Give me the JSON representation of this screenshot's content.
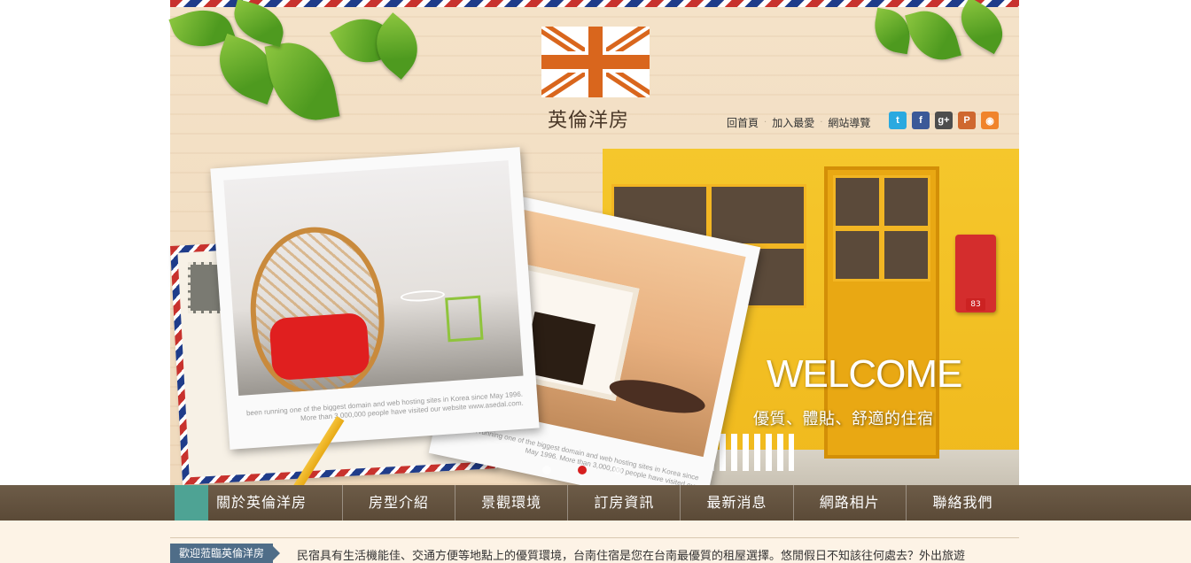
{
  "logo": {
    "name": "英倫洋房"
  },
  "top_links": [
    {
      "label": "回首頁"
    },
    {
      "label": "加入最愛"
    },
    {
      "label": "網站導覽"
    }
  ],
  "socials": [
    {
      "icon": "twitter-icon",
      "glyph": "t",
      "color": "#2aa9e0"
    },
    {
      "icon": "facebook-icon",
      "glyph": "f",
      "color": "#3b5998"
    },
    {
      "icon": "google-plus-icon",
      "glyph": "g+",
      "color": "#4d4d4d"
    },
    {
      "icon": "plurk-icon",
      "glyph": "P",
      "color": "#cf682f"
    },
    {
      "icon": "rss-icon",
      "glyph": "◉",
      "color": "#f0842c"
    }
  ],
  "hero": {
    "headline": "WELCOME",
    "tagline": "優質、體貼、舒適的住宿",
    "mailbox_number": "83",
    "photo1_caption": "been running one of the biggest domain and web hosting sites in Korea since May 1996. More than 3,000,000 people have visited our website www.asedal.com.",
    "photo2_caption": "been running one of the biggest domain and web hosting sites in Korea since May 1996. More than 3,000,000 people have visited our",
    "slides": 3,
    "active_slide": 1
  },
  "nav": {
    "items": [
      {
        "label": "關於英倫洋房"
      },
      {
        "label": "房型介紹"
      },
      {
        "label": "景觀環境"
      },
      {
        "label": "訂房資訊"
      },
      {
        "label": "最新消息"
      },
      {
        "label": "網路相片"
      },
      {
        "label": "聯絡我們"
      }
    ]
  },
  "intro": {
    "tag": "歡迎蒞臨英倫洋房",
    "text": "民宿具有生活機能佳、交通方便等地點上的優質環境，台南住宿是您在台南最優質的租屋選擇。悠閒假日不知該往何處去？外出旅遊"
  },
  "colors": {
    "nav_bg": "#5b4a37",
    "ribbon": "#4ea394",
    "accent_red": "#d61f1f",
    "logo_orange": "#d9661d"
  }
}
